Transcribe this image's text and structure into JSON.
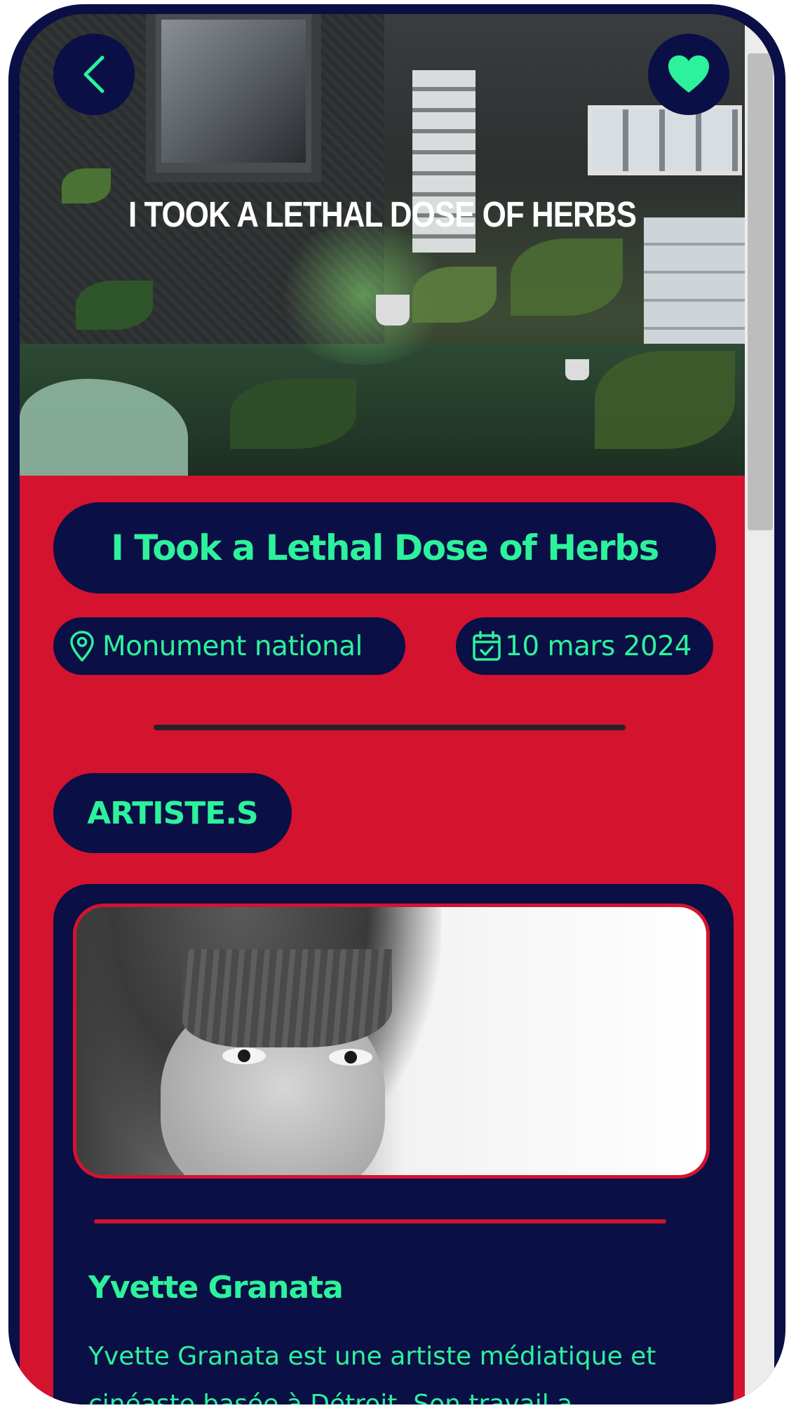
{
  "hero": {
    "caption": "I TOOK A LETHAL DOSE OF HERBS"
  },
  "header": {
    "back_icon": "chevron-left-icon",
    "favorite_icon": "heart-icon"
  },
  "event": {
    "title": "I Took a Lethal Dose of Herbs",
    "location_icon": "map-pin-icon",
    "location": "Monument national",
    "date_icon": "calendar-check-icon",
    "date": "10 mars 2024"
  },
  "artists_section": {
    "label": "ARTISTE.S"
  },
  "artist": {
    "name": "Yvette Granata",
    "bio": "Yvette Granata est une artiste médiatique et cinéaste basée à Détroit. Son travail a"
  },
  "colors": {
    "background": "#d4132f",
    "navy": "#0a0f45",
    "accent": "#2cf29b",
    "divider": "#2a1f2a"
  }
}
